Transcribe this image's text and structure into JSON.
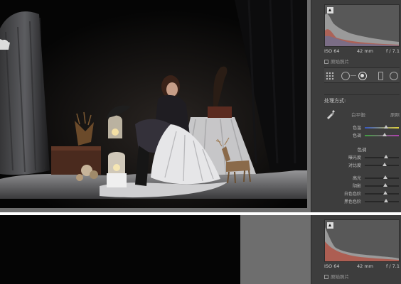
{
  "panel_top": {
    "histogram": {
      "iso": "ISO 64",
      "focal": "42 mm",
      "aperture": "f / 7.1"
    },
    "original_label": "原始照片",
    "process_label": "处理方式:",
    "white_balance": {
      "label": "白平衡:",
      "value": "原照"
    },
    "sliders_wb": [
      {
        "label": "色温",
        "level": 0.62,
        "kind": "temp"
      },
      {
        "label": "色调",
        "level": 0.58,
        "kind": "tint"
      }
    ],
    "tone_section": "色调",
    "sliders_tone": [
      {
        "label": "曝光度",
        "level": 0.62
      },
      {
        "label": "对比度",
        "level": 0.58
      },
      {
        "label": "高光",
        "level": 0.6
      },
      {
        "label": "阴影",
        "level": 0.6
      },
      {
        "label": "白色色阶",
        "level": 0.6
      },
      {
        "label": "黑色色阶",
        "level": 0.62
      }
    ]
  },
  "panel_bottom": {
    "histogram": {
      "iso": "ISO 64",
      "focal": "42 mm",
      "aperture": "f / 7.1"
    },
    "original_label": "原始照片"
  },
  "colors": {
    "panel_bg": "#3d3d3d",
    "canvas_bg": "#6e6e6e",
    "histogram_fill": "#8f8f8f",
    "histogram_red": "#b34a3a"
  },
  "icons": [
    "clipping-warning-icon",
    "grid-tool-icon",
    "crop-circle-icon",
    "spot-removal-icon",
    "red-eye-icon",
    "graduated-filter-icon",
    "radial-filter-icon",
    "eyedropper-icon"
  ]
}
